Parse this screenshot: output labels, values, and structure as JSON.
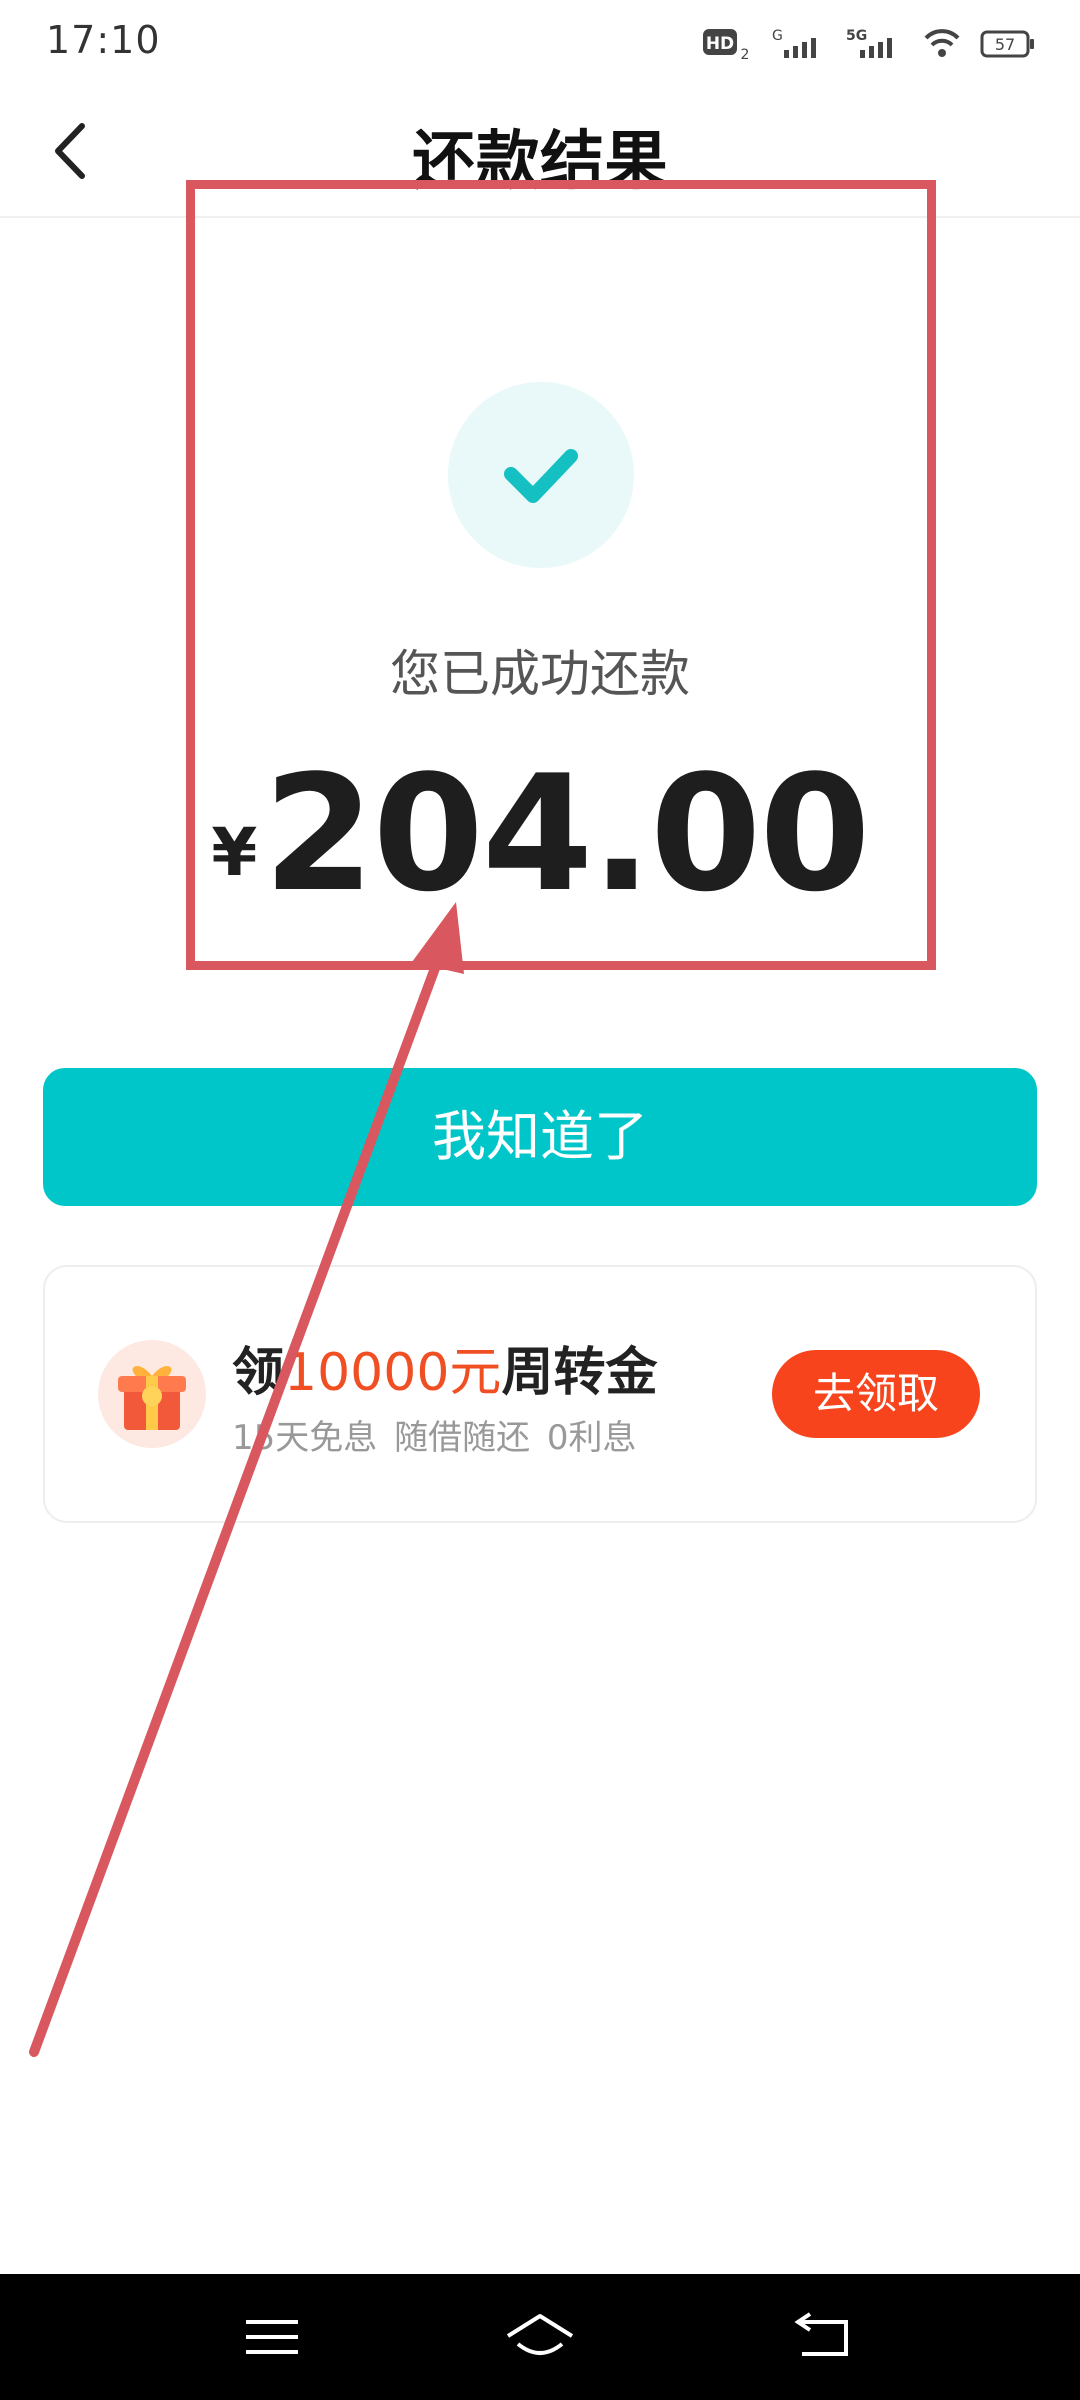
{
  "status_bar": {
    "time": "17:10",
    "icons": [
      "hd-icon",
      "signal-icon",
      "5g-signal-icon",
      "wifi-icon",
      "battery-icon"
    ],
    "hd_label": "HD",
    "hd_sub": "2",
    "g_label": "G",
    "fiveg_label": "5G",
    "battery": "57"
  },
  "header": {
    "back_icon": "chevron-left-icon",
    "title": "还款结果"
  },
  "result": {
    "icon": "check-icon",
    "message": "您已成功还款",
    "currency": "¥",
    "amount": "204.00"
  },
  "actions": {
    "confirm_label": "我知道了"
  },
  "promo": {
    "icon": "gift-icon",
    "title_prefix": "领",
    "title_highlight": "10000元",
    "title_suffix": "周转金",
    "subtitle": "15天免息 随借随还 0利息",
    "button_label": "去领取"
  },
  "nav": {
    "icons": [
      "menu-icon",
      "home-icon",
      "back-icon"
    ]
  },
  "colors": {
    "accent": "#00c6c9",
    "promo_orange": "#f04e23",
    "annotation_red": "#d9575f"
  }
}
